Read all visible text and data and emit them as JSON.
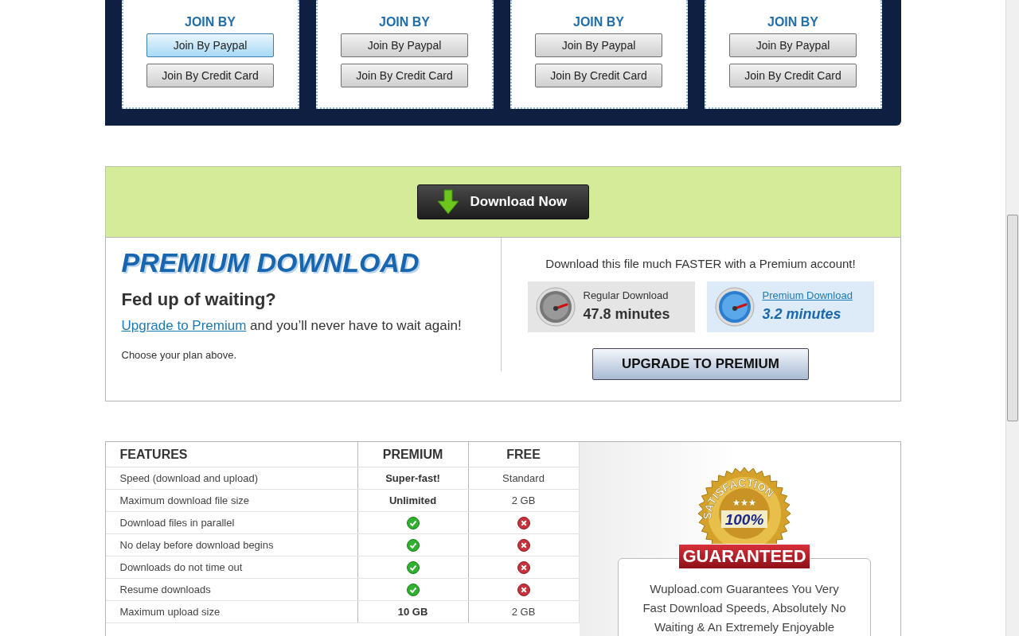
{
  "plans": [
    {
      "join_label": "JOIN BY",
      "buttons": [
        {
          "label": "Join By Paypal",
          "highlighted": true
        },
        {
          "label": "Join By Credit Card",
          "highlighted": false
        }
      ]
    },
    {
      "join_label": "JOIN BY",
      "buttons": [
        {
          "label": "Join By Paypal",
          "highlighted": false
        },
        {
          "label": "Join By Credit Card",
          "highlighted": false
        }
      ]
    },
    {
      "join_label": "JOIN BY",
      "buttons": [
        {
          "label": "Join By Paypal",
          "highlighted": false
        },
        {
          "label": "Join By Credit Card",
          "highlighted": false
        }
      ]
    },
    {
      "join_label": "JOIN BY",
      "buttons": [
        {
          "label": "Join By Paypal",
          "highlighted": false
        },
        {
          "label": "Join By Credit Card",
          "highlighted": false
        }
      ]
    }
  ],
  "download_button": "Download Now",
  "premium": {
    "title": "PREMIUM DOWNLOAD",
    "heading": "Fed up of waiting?",
    "link": "Upgrade to Premium",
    "sentence_rest": " and you’ll never have to wait again!",
    "note": "Choose your plan above.",
    "tagline": "Download this file much FASTER with a Premium account!",
    "speeds": [
      {
        "kind": "regular",
        "label": "Regular Download",
        "time": "47.8 minutes"
      },
      {
        "kind": "premium",
        "label": "Premium Download",
        "time": "3.2 minutes"
      }
    ],
    "upgrade_button": "UPGRADE TO PREMIUM"
  },
  "table": {
    "columns": [
      "FEATURES",
      "PREMIUM",
      "FREE"
    ],
    "rows": [
      {
        "cells": [
          {
            "kind": "feature",
            "text": "Speed (download and upload)"
          },
          {
            "kind": "bold",
            "text": "Super-fast!"
          },
          {
            "kind": "text",
            "text": "Standard"
          }
        ]
      },
      {
        "cells": [
          {
            "kind": "feature",
            "text": "Maximum download file size"
          },
          {
            "kind": "bold",
            "text": "Unlimited"
          },
          {
            "kind": "text",
            "text": "2 GB"
          }
        ]
      },
      {
        "cells": [
          {
            "kind": "feature",
            "text": "Download files in parallel"
          },
          {
            "kind": "yes"
          },
          {
            "kind": "no"
          }
        ]
      },
      {
        "cells": [
          {
            "kind": "feature",
            "text": "No delay before download begins"
          },
          {
            "kind": "yes"
          },
          {
            "kind": "no"
          }
        ]
      },
      {
        "cells": [
          {
            "kind": "feature",
            "text": "Downloads do not time out"
          },
          {
            "kind": "yes"
          },
          {
            "kind": "no"
          }
        ]
      },
      {
        "cells": [
          {
            "kind": "feature",
            "text": "Resume downloads"
          },
          {
            "kind": "yes"
          },
          {
            "kind": "no"
          }
        ]
      },
      {
        "cells": [
          {
            "kind": "feature",
            "text": "Maximum upload size"
          },
          {
            "kind": "bold",
            "text": "10 GB"
          },
          {
            "kind": "text",
            "text": "2 GB"
          }
        ]
      }
    ]
  },
  "guarantee": {
    "seal_arc": "SATISFACTION",
    "seal_stars": "★★★",
    "seal_percent": "100%",
    "seal_ribbon": "GUARANTEED",
    "lines": [
      "Wupload.com Guarantees You Very",
      "Fast Download Speeds, Absolutely No",
      "Waiting & An Extremely Enjoyable"
    ]
  }
}
